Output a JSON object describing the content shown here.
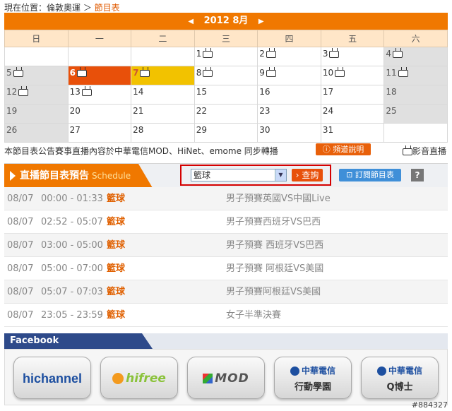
{
  "breadcrumb": {
    "prefix": "現在位置：倫敦奧運 ＞ ",
    "current": "節目表"
  },
  "calendar": {
    "title": "2012 8月",
    "weekdays": [
      "日",
      "一",
      "二",
      "三",
      "四",
      "五",
      "六"
    ],
    "weeks": [
      [
        "",
        "",
        "",
        "1",
        "2",
        "3",
        "4"
      ],
      [
        "5",
        "6",
        "7",
        "8",
        "9",
        "10",
        "11"
      ],
      [
        "12",
        "13",
        "14",
        "15",
        "16",
        "17",
        "18"
      ],
      [
        "19",
        "20",
        "21",
        "22",
        "23",
        "24",
        "25"
      ],
      [
        "26",
        "27",
        "28",
        "29",
        "30",
        "31",
        ""
      ]
    ],
    "tv_days": [
      "1",
      "2",
      "3",
      "4",
      "5",
      "6",
      "7",
      "8",
      "9",
      "10",
      "11",
      "12",
      "13"
    ],
    "selected_days": [
      "6",
      "7"
    ]
  },
  "note": {
    "text": "本節目表公告賽事直播內容於中華電信MOD、HiNet、emome 同步轉播",
    "channel_button": "頻道說明",
    "legend": "影音直播"
  },
  "schedule": {
    "title": "直播節目表預告",
    "title_en": "Schedule",
    "select_value": "籃球",
    "query_button": "查詢",
    "subscribe_button": "訂閱節目表",
    "help_button": "?",
    "rows": [
      {
        "date": "08/07",
        "time": "00:00 - 01:33",
        "category": "籃球",
        "program": "男子預賽英國VS中國Live"
      },
      {
        "date": "08/07",
        "time": "02:52 - 05:07",
        "category": "籃球",
        "program": "男子預賽西班牙VS巴西"
      },
      {
        "date": "08/07",
        "time": "03:00 - 05:00",
        "category": "籃球",
        "program": "男子預賽 西班牙VS巴西"
      },
      {
        "date": "08/07",
        "time": "05:00 - 07:00",
        "category": "籃球",
        "program": "男子預賽 阿根廷VS美國"
      },
      {
        "date": "08/07",
        "time": "05:07 - 07:03",
        "category": "籃球",
        "program": "男子預賽阿根廷VS美國"
      },
      {
        "date": "08/07",
        "time": "23:05 - 23:59",
        "category": "籃球",
        "program": "女子半準決賽"
      }
    ]
  },
  "facebook": {
    "tab": "Facebook"
  },
  "partners": {
    "hichannel": "hichannel",
    "hifree": "hifree",
    "mod": "MOD",
    "cht1_top": "中華電信",
    "cht1_bottom": "行動學園",
    "cht2_top": "中華電信",
    "cht2_bottom": "Q博士"
  },
  "watermark": "#884327"
}
